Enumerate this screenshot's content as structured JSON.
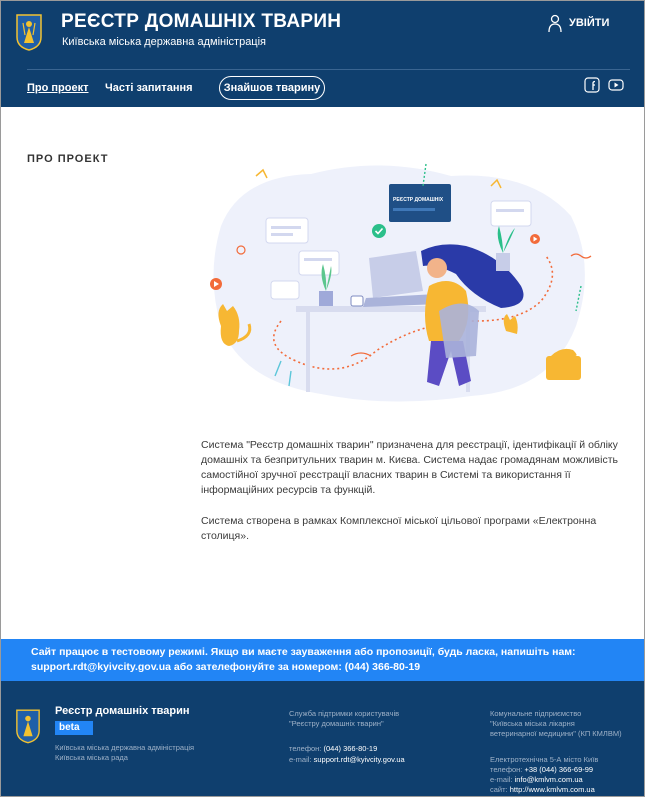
{
  "header": {
    "title": "РЕЄСТР ДОМАШНІХ ТВАРИН",
    "subtitle": "Київська міська державна адміністрація",
    "login_label": "УВІЙТИ"
  },
  "nav": {
    "items": [
      "Про проект",
      "Часті запитання"
    ],
    "cta_label": "Знайшов тварину",
    "social": [
      "facebook-icon",
      "youtube-icon"
    ]
  },
  "main": {
    "section_title": "ПРО ПРОЕКТ",
    "paragraph1": "Система \"Реєстр домашніх тварин\" призначена для реєстрації, ідентифікації й обліку домашніх та безпритульних тварин м. Києва. Система надає громадянам можливість самостійної зручної реєстрації власних тварин в Системі та використання її інформаційних ресурсів та функцій.",
    "paragraph2": "Система створена в рамках Комплексної міської цільової програми «Електронна столиця».",
    "illustration_sign": "РЕЄСТР ДОМАШНІХ"
  },
  "notice": {
    "line1": "Сайт працює в тестовому режимі. Якщо ви маєте зауваження або пропозиції, будь ласка, напишіть нам:",
    "line2": "support.rdt@kyivcity.gov.ua або зателефонуйте за номером: (044) 366-80-19"
  },
  "footer": {
    "brand": "Реєстр домашніх тварин",
    "beta": "beta",
    "org1": "Київська міська державна адміністрація",
    "org2": "Київська міська рада",
    "support": {
      "title1": "Служба підтримки користувачів",
      "title2": "\"Реєстру домашніх тварин\"",
      "phone_label": "телефон:",
      "phone": "(044) 366-80-19",
      "email_label": "e-mail:",
      "email": "support.rdt@kyivcity.gov.ua"
    },
    "clinic": {
      "title1": "Комунальне підприємство",
      "title2": "\"Київська міська лікарня",
      "title3": "ветеринарної медицини\" (КП КМЛВМ)",
      "address": "Електротехнічна 5-А місто Київ",
      "phone_label": "телефон:",
      "phone": "+38 (044) 366-69-99",
      "email_label": "e-mail:",
      "email": "info@kmlvm.com.ua",
      "site_label": "сайт:",
      "site": "http://www.kmlvm.com.ua"
    }
  },
  "colors": {
    "header_bg": "#0f3f6e",
    "notice_bg": "#2285f5",
    "footer_bg": "#0f3f6e"
  }
}
